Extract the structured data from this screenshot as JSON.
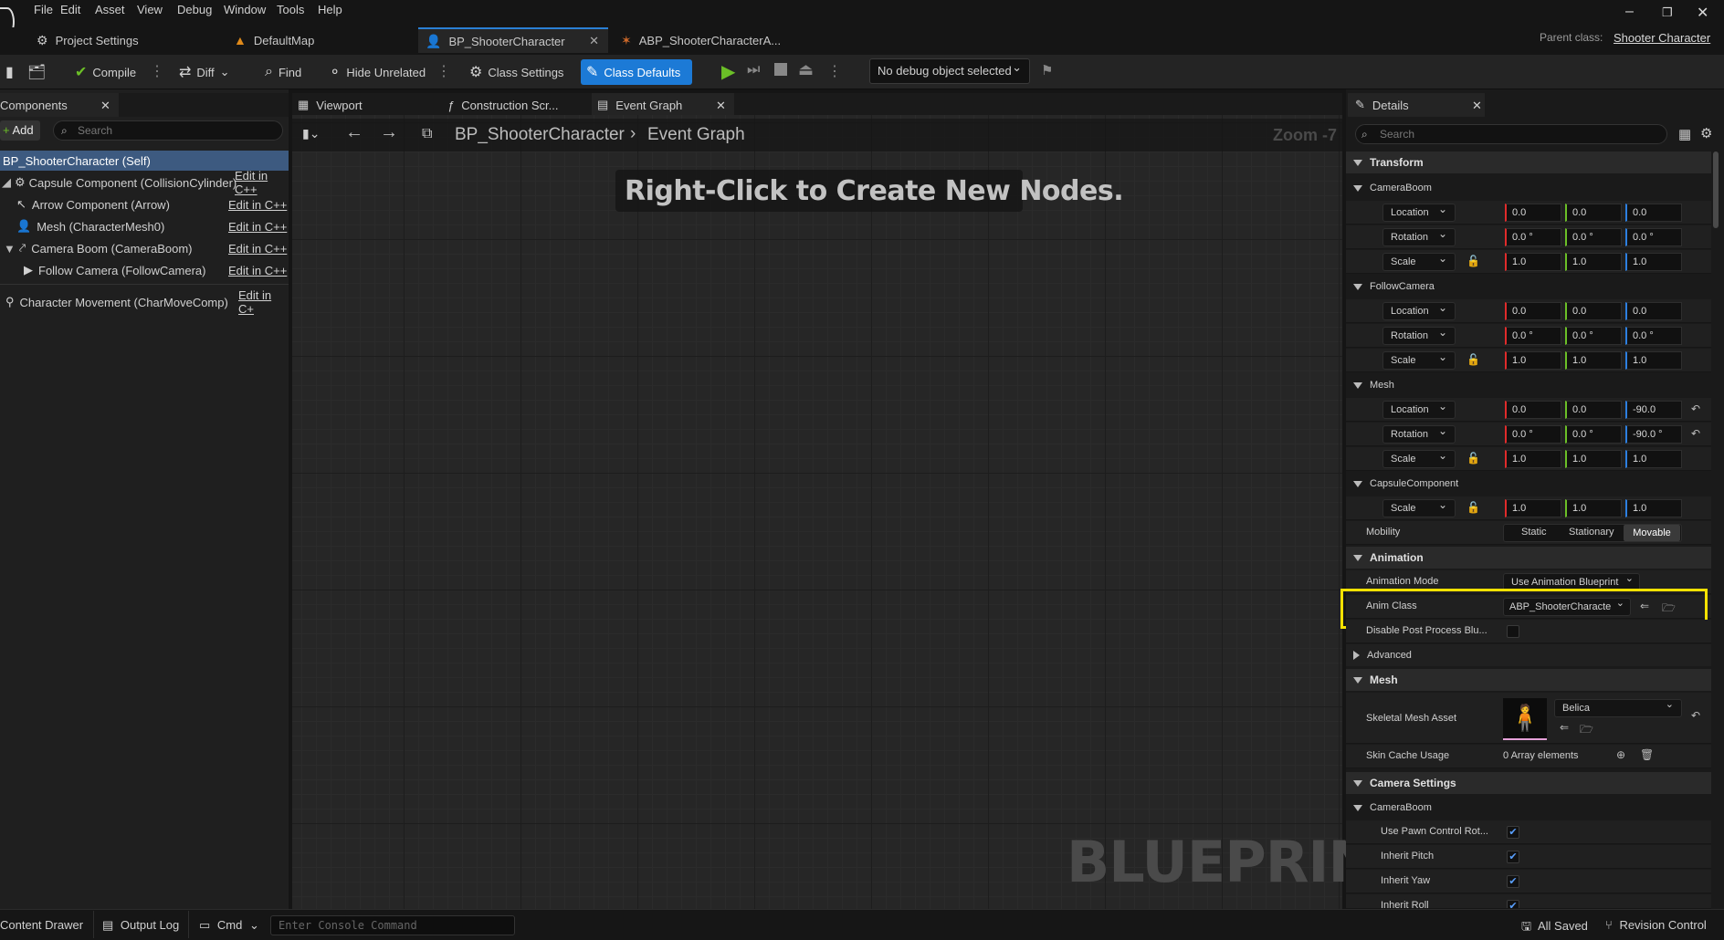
{
  "menu": [
    "File",
    "Edit",
    "Asset",
    "View",
    "Debug",
    "Window",
    "Tools",
    "Help"
  ],
  "tabs": {
    "project_settings": "Project Settings",
    "default_map": "DefaultMap",
    "bp_shooter": "BP_ShooterCharacter",
    "abp_shooter": "ABP_ShooterCharacterA..."
  },
  "parent_class": {
    "label": "Parent class:",
    "value": "Shooter Character"
  },
  "toolbar": {
    "compile": "Compile",
    "diff": "Diff",
    "find": "Find",
    "hide_unrelated": "Hide Unrelated",
    "class_settings": "Class Settings",
    "class_defaults": "Class Defaults",
    "debug_object": "No debug object selected"
  },
  "components": {
    "title": "Components",
    "add": "Add",
    "search_placeholder": "Search",
    "self": "BP_ShooterCharacter (Self)",
    "edit_label": "Edit in C++",
    "edit_label_trunc": "Edit in C+",
    "items": [
      "Capsule Component (CollisionCylinder)",
      "Arrow Component (Arrow)",
      "Mesh (CharacterMesh0)",
      "Camera Boom (CameraBoom)",
      "Follow Camera (FollowCamera)",
      "Character Movement (CharMoveComp)"
    ]
  },
  "graph": {
    "tabs": [
      "Viewport",
      "Construction Scr...",
      "Event Graph"
    ],
    "breadcrumb_root": "BP_ShooterCharacter",
    "breadcrumb_leaf": "Event Graph",
    "zoom": "Zoom -7",
    "hint": "Right-Click to Create New Nodes.",
    "watermark": "BLUEPRINT"
  },
  "details": {
    "title": "Details",
    "search_placeholder": "Search",
    "transform": "Transform",
    "camera_boom": "CameraBoom",
    "follow_camera": "FollowCamera",
    "mesh": "Mesh",
    "capsule": "CapsuleComponent",
    "location": "Location",
    "rotation": "Rotation",
    "scale": "Scale",
    "zero": "0.0",
    "zero_deg": "0.0 °",
    "one": "1.0",
    "neg90": "-90.0",
    "neg90_deg": "-90.0 °",
    "mobility": "Mobility",
    "mobility_opts": [
      "Static",
      "Stationary",
      "Movable"
    ],
    "animation": "Animation",
    "animation_mode_label": "Animation Mode",
    "animation_mode_value": "Use Animation Blueprint",
    "anim_class_label": "Anim Class",
    "anim_class_value": "ABP_ShooterCharacte",
    "disable_post": "Disable Post Process Blu...",
    "advanced": "Advanced",
    "mesh_section": "Mesh",
    "skeletal_mesh_label": "Skeletal Mesh Asset",
    "skeletal_mesh_value": "Belica",
    "skin_cache_label": "Skin Cache Usage",
    "skin_cache_value": "0 Array elements",
    "camera_settings": "Camera Settings",
    "camera_boom2": "CameraBoom",
    "use_pawn": "Use Pawn Control Rot...",
    "inherit_pitch": "Inherit Pitch",
    "inherit_yaw": "Inherit Yaw",
    "inherit_roll": "Inherit Roll"
  },
  "status": {
    "content_drawer": "Content Drawer",
    "output_log": "Output Log",
    "cmd": "Cmd",
    "console_placeholder": "Enter Console Command",
    "all_saved": "All Saved",
    "revision": "Revision Control"
  },
  "colors": {
    "accent": "#1c7ad6",
    "highlight": "#f5e100",
    "selection": "#3d5a80"
  }
}
